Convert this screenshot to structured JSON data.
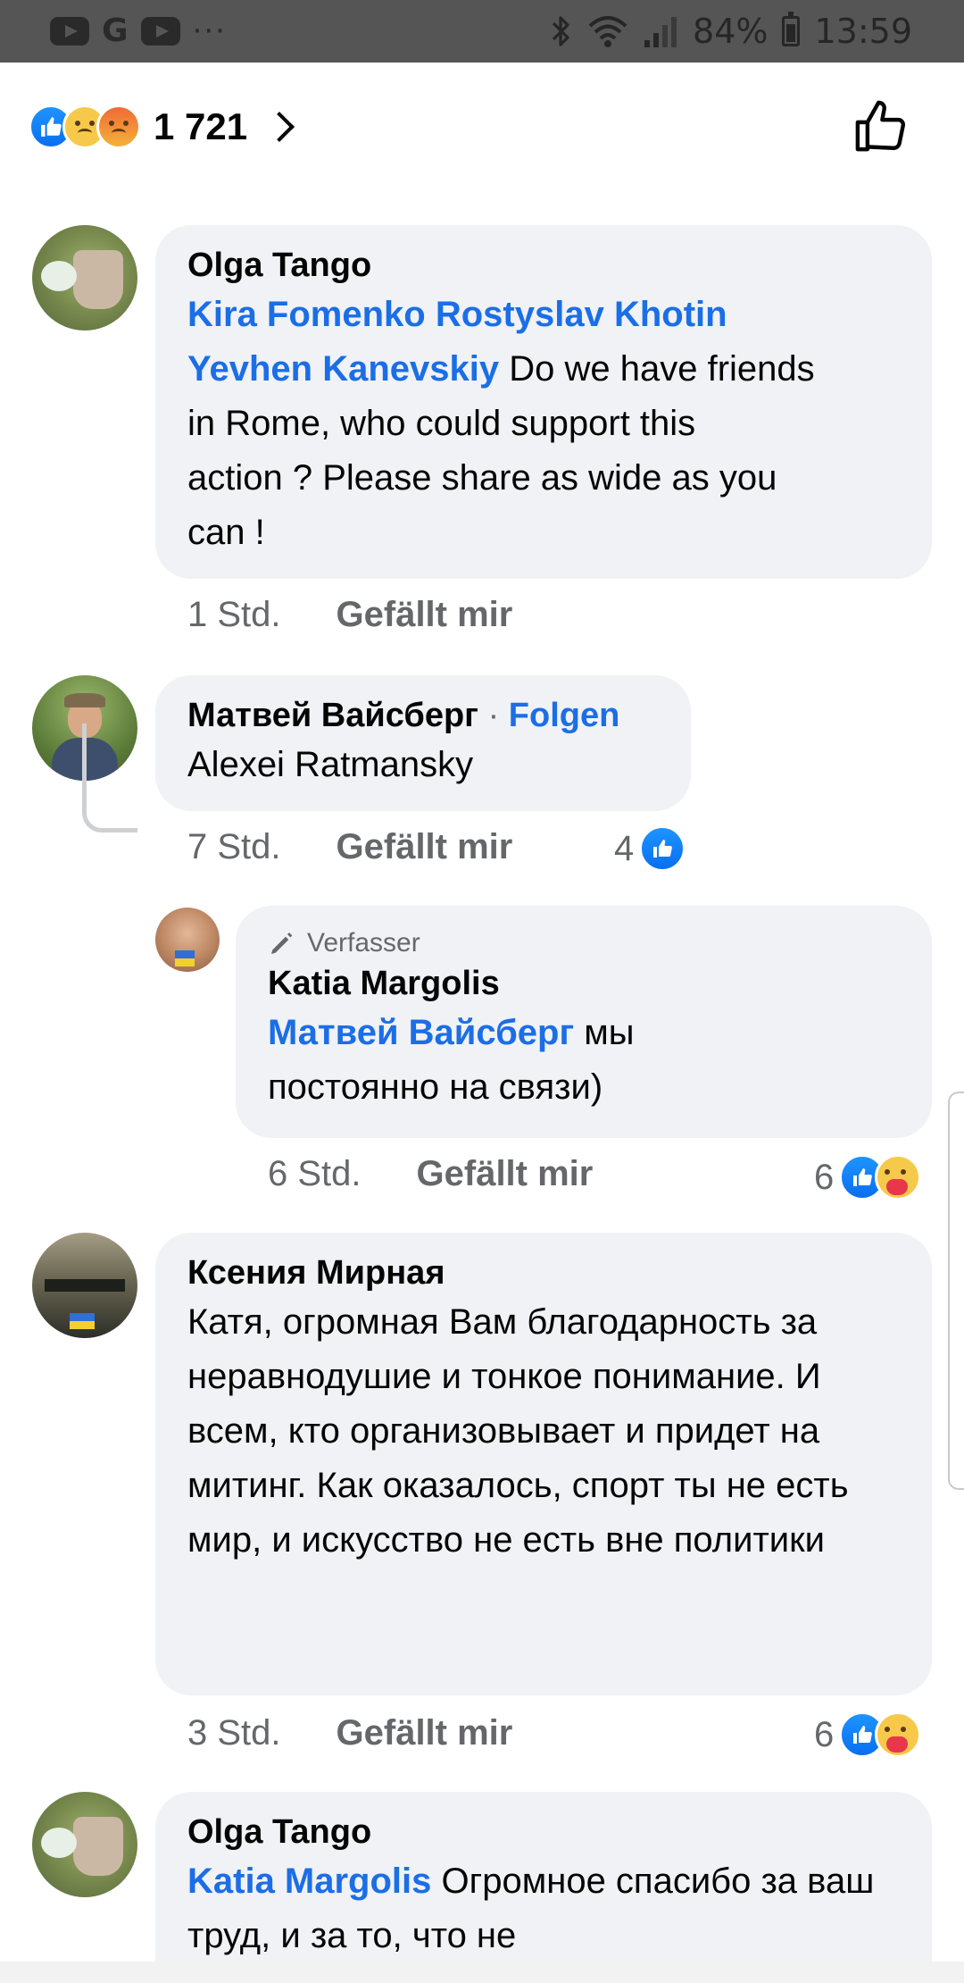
{
  "status_bar": {
    "left_icons": [
      "youtube-icon",
      "google-icon",
      "youtube-icon",
      "more-icon"
    ],
    "g_letter": "G",
    "dots": "···",
    "battery": "84%",
    "time": "13:59"
  },
  "reactions_bar": {
    "emojis": [
      "like",
      "sad",
      "angry"
    ],
    "count": "1 721"
  },
  "comments": [
    {
      "author": "Olga Tango",
      "mentions": [
        "Kira Fomenko",
        "Rostyslav Khotin",
        "Yevhen Kanevskiy"
      ],
      "text": "Do we have friends in Rome, who could support this action ? Please share as wide as you can !",
      "time": "1 Std.",
      "like_label": "Gefällt mir"
    },
    {
      "author": "Матвей Вайсберг",
      "follow_label": "Folgen",
      "text": "Alexei Ratmansky",
      "time": "7 Std.",
      "like_label": "Gefällt mir",
      "reaction_count": "4"
    },
    {
      "badge": "Verfasser",
      "author": "Katia Margolis",
      "mention": "Матвей Вайсберг",
      "text": "мы постоянно на связи)",
      "time": "6 Std.",
      "like_label": "Gefällt mir",
      "reaction_count": "6"
    },
    {
      "author": "Ксения Мирная",
      "text": "Катя, огромная Вам благодарность за неравнодушие и тонкое понимание. И всем, кто организовывает и придет на митинг. Как оказалось, спорт ты не есть мир, и искусство не есть вне политики",
      "time": "3 Std.",
      "like_label": "Gefällt mir",
      "reaction_count": "6"
    },
    {
      "author": "Olga Tango",
      "mention": "Katia Margolis",
      "text": "Огромное спасибо за ваш труд, и за то, что не"
    }
  ]
}
